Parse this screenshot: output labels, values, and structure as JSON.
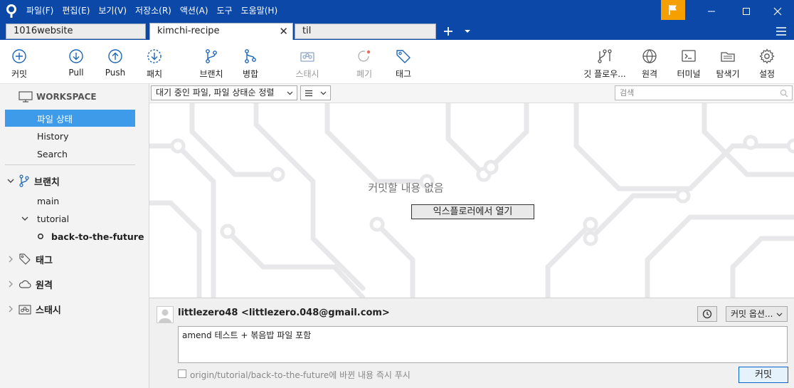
{
  "menu": [
    "파일(F)",
    "편집(E)",
    "보기(V)",
    "저장소(R)",
    "액션(A)",
    "도구",
    "도움말(H)"
  ],
  "tabs": [
    {
      "label": "1016website"
    },
    {
      "label": "kimchi-recipe"
    },
    {
      "label": "til"
    }
  ],
  "toolbar": {
    "commit": "커밋",
    "pull": "Pull",
    "push": "Push",
    "patch": "패치",
    "branch": "브랜치",
    "merge": "병합",
    "stash": "스태시",
    "discard": "폐기",
    "tag": "태그",
    "gitflow": "깃 플로우...",
    "remote": "원격",
    "terminal": "터미널",
    "explorer": "탐색기",
    "settings": "설정"
  },
  "sidebar": {
    "workspace": "WORKSPACE",
    "file_status": "파일 상태",
    "history": "History",
    "search": "Search",
    "branches": "브랜치",
    "main": "main",
    "tutorial": "tutorial",
    "current_branch": "back-to-the-future",
    "tags": "태그",
    "remotes": "원격",
    "stashes": "스태시"
  },
  "filter": {
    "file_filter": "대기 중인 파일, 파일 상태순 정렬",
    "search_placeholder": "검색"
  },
  "empty": {
    "message": "커밋할 내용 없음",
    "open_explorer": "익스플로러에서 열기"
  },
  "commit": {
    "author": "littlezero48 <littlezero.048@gmail.com>",
    "options": "커밋 옵션...",
    "message": "amend 테스트 + 볶음밥 파일 포함",
    "push_label": "origin/tutorial/back-to-the-future에 바뀐 내용 즉시 푸시",
    "commit_button": "커밋"
  },
  "colors": {
    "titlebar": "#0b48a7",
    "selection": "#3d9be9",
    "flag": "#f5a000",
    "icon_blue": "#1c66b8"
  }
}
